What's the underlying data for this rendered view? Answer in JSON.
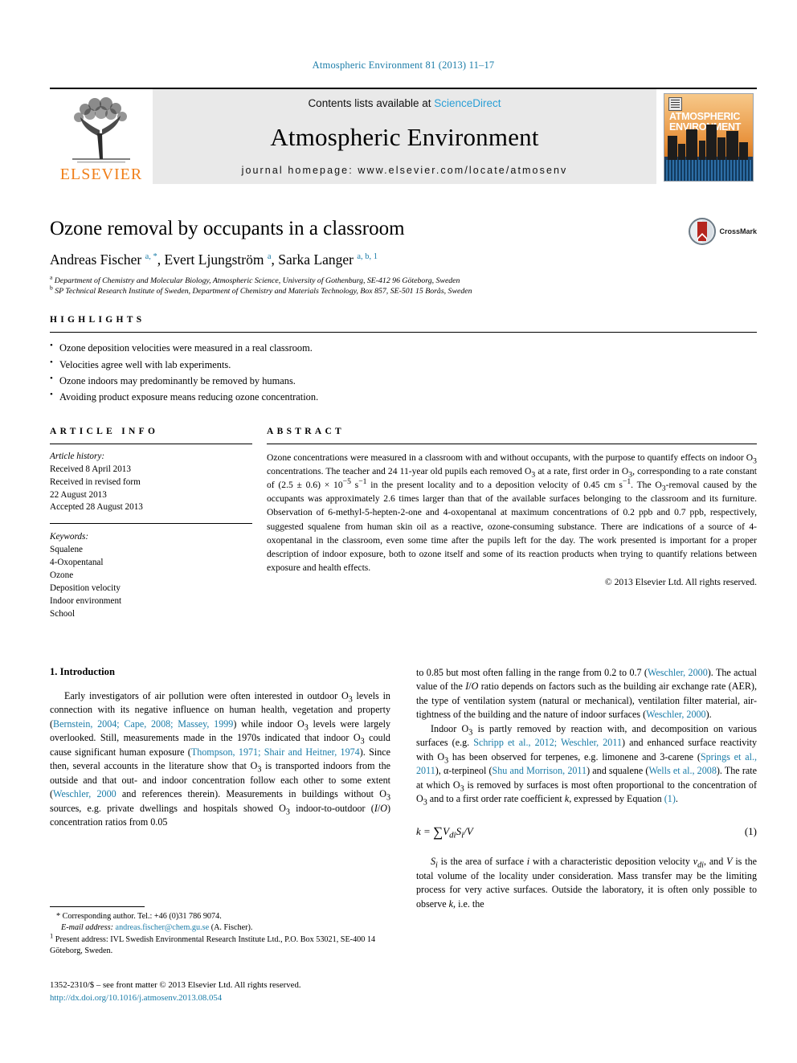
{
  "running_head": "Atmospheric Environment 81 (2013) 11–17",
  "masthead": {
    "elsevier_wordmark": "ELSEVIER",
    "contents_prefix": "Contents lists available at ",
    "contents_link": "ScienceDirect",
    "journal_title": "Atmospheric Environment",
    "homepage": "journal homepage: www.elsevier.com/locate/atmosenv",
    "cover_title_line1": "ATMOSPHERIC",
    "cover_title_line2": "ENVIRONMENT"
  },
  "article": {
    "title": "Ozone removal by occupants in a classroom",
    "authors_html": "Andreas Fischer <sup>a, *</sup>, Evert Ljungström <sup>a</sup>, Sarka Langer <sup>a, b, 1</sup>",
    "affiliation_a": "Department of Chemistry and Molecular Biology, Atmospheric Science, University of Gothenburg, SE-412 96 Göteborg, Sweden",
    "affiliation_b": "SP Technical Research Institute of Sweden, Department of Chemistry and Materials Technology, Box 857, SE-501 15 Borås, Sweden",
    "crossmark_label": "CrossMark"
  },
  "highlights": {
    "heading": "HIGHLIGHTS",
    "items": [
      "Ozone deposition velocities were measured in a real classroom.",
      "Velocities agree well with lab experiments.",
      "Ozone indoors may predominantly be removed by humans.",
      "Avoiding product exposure means reducing ozone concentration."
    ]
  },
  "article_info": {
    "heading": "ARTICLE INFO",
    "history_label": "Article history:",
    "history": [
      "Received 8 April 2013",
      "Received in revised form",
      "22 August 2013",
      "Accepted 28 August 2013"
    ],
    "keywords_label": "Keywords:",
    "keywords": [
      "Squalene",
      "4-Oxopentanal",
      "Ozone",
      "Deposition velocity",
      "Indoor environment",
      "School"
    ]
  },
  "abstract": {
    "heading": "ABSTRACT",
    "text_html": "Ozone concentrations were measured in a classroom with and without occupants, with the purpose to quantify effects on indoor O<sub>3</sub> concentrations. The teacher and 24 11-year old pupils each removed O<sub>3</sub> at a rate, first order in O<sub>3</sub>, corresponding to a rate constant of (2.5 ± 0.6) × 10<sup>−5</sup> s<sup>−1</sup> in the present locality and to a deposition velocity of 0.45 cm s<sup>−1</sup>. The O<sub>3</sub>-removal caused by the occupants was approximately 2.6 times larger than that of the available surfaces belonging to the classroom and its furniture. Observation of 6-methyl-5-hepten-2-one and 4-oxopentanal at maximum concentrations of 0.2 ppb and 0.7 ppb, respectively, suggested squalene from human skin oil as a reactive, ozone-consuming substance. There are indications of a source of 4-oxopentanal in the classroom, even some time after the pupils left for the day. The work presented is important for a proper description of indoor exposure, both to ozone itself and some of its reaction products when trying to quantify relations between exposure and health effects.",
    "copyright": "© 2013 Elsevier Ltd. All rights reserved."
  },
  "introduction": {
    "heading": "1. Introduction",
    "para1_html": "Early investigators of air pollution were often interested in outdoor O<sub>3</sub> levels in connection with its negative influence on human health, vegetation and property (<span class=\"ref\">Bernstein, 2004; Cape, 2008; Massey, 1999</span>) while indoor O<sub>3</sub> levels were largely overlooked. Still, measurements made in the 1970s indicated that indoor O<sub>3</sub> could cause significant human exposure (<span class=\"ref\">Thompson, 1971; Shair and Heitner, 1974</span>). Since then, several accounts in the literature show that O<sub>3</sub> is transported indoors from the outside and that out- and indoor concentration follow each other to some extent (<span class=\"ref\">Weschler, 2000</span> and references therein). Measurements in buildings without O<sub>3</sub> sources, e.g. private dwellings and hospitals showed O<sub>3</sub> indoor-to-outdoor (<i>I</i>/<i>O</i>) concentration ratios from 0.05",
    "para1_cont_html": "to 0.85 but most often falling in the range from 0.2 to 0.7 (<span class=\"ref\">Weschler, 2000</span>). The actual value of the <i>I</i>/<i>O</i> ratio depends on factors such as the building air exchange rate (AER), the type of ventilation system (natural or mechanical), ventilation filter material, air-tightness of the building and the nature of indoor surfaces (<span class=\"ref\">Weschler, 2000</span>).",
    "para2_html": "Indoor O<sub>3</sub> is partly removed by reaction with, and decomposition on various surfaces (e.g. <span class=\"ref\">Schripp et al., 2012; Weschler, 2011</span>) and enhanced surface reactivity with O<sub>3</sub> has been observed for terpenes, e.g. limonene and 3-carene (<span class=\"ref\">Springs et al., 2011</span>), α-terpineol (<span class=\"ref\">Shu and Morrison, 2011</span>) and squalene (<span class=\"ref\">Wells et al., 2008</span>). The rate at which O<sub>3</sub> is removed by surfaces is most often proportional to the concentration of O<sub>3</sub> and to a first order rate coefficient <i>k</i>, expressed by Equation <span class=\"ref\">(1)</span>.",
    "equation_html": "k = <span class=\"sum\">∑</span>V<sub>di</sub>S<sub>i</sub>/V",
    "equation_number": "(1)",
    "para3_html": "<i>S<sub>i</sub></i> is the area of surface <i>i</i> with a characteristic deposition velocity <i>v<sub>di</sub></i>, and <i>V</i> is the total volume of the locality under consideration. Mass transfer may be the limiting process for very active surfaces. Outside the laboratory, it is often only possible to observe <i>k</i>, i.e. the"
  },
  "footnotes": {
    "corresponding_html": "* Corresponding author. Tel.: +46 (0)31 786 9074.",
    "email_html": "<span class=\"ital\">E-mail address:</span> <span class=\"ref\">andreas.fischer@chem.gu.se</span> (A. Fischer).",
    "present_address_html": "<sup>1</sup> Present address: IVL Swedish Environmental Research Institute Ltd., P.O. Box 53021, SE-400 14 Göteborg, Sweden."
  },
  "imprint": {
    "line1": "1352-2310/$ – see front matter © 2013 Elsevier Ltd. All rights reserved.",
    "doi": "http://dx.doi.org/10.1016/j.atmosenv.2013.08.054"
  }
}
